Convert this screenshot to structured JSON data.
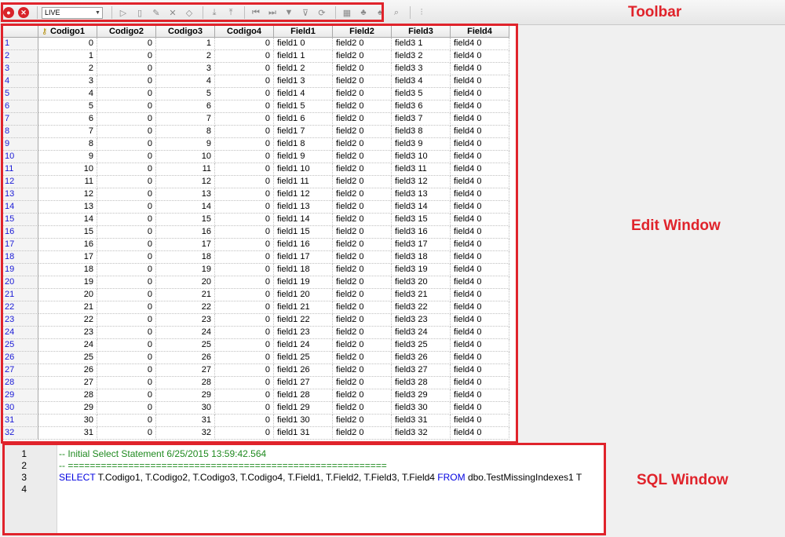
{
  "toolbar": {
    "caption": "Toolbar",
    "connection_value": "LIVE",
    "icons": [
      "stop-icon",
      "cancel-icon",
      "run-icon",
      "new-record-icon",
      "edit-icon",
      "delete-icon",
      "eraser-icon",
      "import-icon",
      "export-icon",
      "first-record-icon",
      "last-record-icon",
      "filter-icon",
      "filter-options-icon",
      "refresh-icon",
      "table-view-icon",
      "group-icon",
      "sort-icon",
      "lookup-icon",
      "split-icon"
    ]
  },
  "edit_window": {
    "caption": "Edit Window",
    "columns": [
      "Codigo1",
      "Codigo2",
      "Codigo3",
      "Codigo4",
      "Field1",
      "Field2",
      "Field3",
      "Field4"
    ],
    "rows": [
      [
        "1",
        "0",
        "0",
        "1",
        "0",
        "field1 0",
        "field2 0",
        "field3 1",
        "field4 0"
      ],
      [
        "2",
        "1",
        "0",
        "2",
        "0",
        "field1 1",
        "field2 0",
        "field3 2",
        "field4 0"
      ],
      [
        "3",
        "2",
        "0",
        "3",
        "0",
        "field1 2",
        "field2 0",
        "field3 3",
        "field4 0"
      ],
      [
        "4",
        "3",
        "0",
        "4",
        "0",
        "field1 3",
        "field2 0",
        "field3 4",
        "field4 0"
      ],
      [
        "5",
        "4",
        "0",
        "5",
        "0",
        "field1 4",
        "field2 0",
        "field3 5",
        "field4 0"
      ],
      [
        "6",
        "5",
        "0",
        "6",
        "0",
        "field1 5",
        "field2 0",
        "field3 6",
        "field4 0"
      ],
      [
        "7",
        "6",
        "0",
        "7",
        "0",
        "field1 6",
        "field2 0",
        "field3 7",
        "field4 0"
      ],
      [
        "8",
        "7",
        "0",
        "8",
        "0",
        "field1 7",
        "field2 0",
        "field3 8",
        "field4 0"
      ],
      [
        "9",
        "8",
        "0",
        "9",
        "0",
        "field1 8",
        "field2 0",
        "field3 9",
        "field4 0"
      ],
      [
        "10",
        "9",
        "0",
        "10",
        "0",
        "field1 9",
        "field2 0",
        "field3 10",
        "field4 0"
      ],
      [
        "11",
        "10",
        "0",
        "11",
        "0",
        "field1 10",
        "field2 0",
        "field3 11",
        "field4 0"
      ],
      [
        "12",
        "11",
        "0",
        "12",
        "0",
        "field1 11",
        "field2 0",
        "field3 12",
        "field4 0"
      ],
      [
        "13",
        "12",
        "0",
        "13",
        "0",
        "field1 12",
        "field2 0",
        "field3 13",
        "field4 0"
      ],
      [
        "14",
        "13",
        "0",
        "14",
        "0",
        "field1 13",
        "field2 0",
        "field3 14",
        "field4 0"
      ],
      [
        "15",
        "14",
        "0",
        "15",
        "0",
        "field1 14",
        "field2 0",
        "field3 15",
        "field4 0"
      ],
      [
        "16",
        "15",
        "0",
        "16",
        "0",
        "field1 15",
        "field2 0",
        "field3 16",
        "field4 0"
      ],
      [
        "17",
        "16",
        "0",
        "17",
        "0",
        "field1 16",
        "field2 0",
        "field3 17",
        "field4 0"
      ],
      [
        "18",
        "17",
        "0",
        "18",
        "0",
        "field1 17",
        "field2 0",
        "field3 18",
        "field4 0"
      ],
      [
        "19",
        "18",
        "0",
        "19",
        "0",
        "field1 18",
        "field2 0",
        "field3 19",
        "field4 0"
      ],
      [
        "20",
        "19",
        "0",
        "20",
        "0",
        "field1 19",
        "field2 0",
        "field3 20",
        "field4 0"
      ],
      [
        "21",
        "20",
        "0",
        "21",
        "0",
        "field1 20",
        "field2 0",
        "field3 21",
        "field4 0"
      ],
      [
        "22",
        "21",
        "0",
        "22",
        "0",
        "field1 21",
        "field2 0",
        "field3 22",
        "field4 0"
      ],
      [
        "23",
        "22",
        "0",
        "23",
        "0",
        "field1 22",
        "field2 0",
        "field3 23",
        "field4 0"
      ],
      [
        "24",
        "23",
        "0",
        "24",
        "0",
        "field1 23",
        "field2 0",
        "field3 24",
        "field4 0"
      ],
      [
        "25",
        "24",
        "0",
        "25",
        "0",
        "field1 24",
        "field2 0",
        "field3 25",
        "field4 0"
      ],
      [
        "26",
        "25",
        "0",
        "26",
        "0",
        "field1 25",
        "field2 0",
        "field3 26",
        "field4 0"
      ],
      [
        "27",
        "26",
        "0",
        "27",
        "0",
        "field1 26",
        "field2 0",
        "field3 27",
        "field4 0"
      ],
      [
        "28",
        "27",
        "0",
        "28",
        "0",
        "field1 27",
        "field2 0",
        "field3 28",
        "field4 0"
      ],
      [
        "29",
        "28",
        "0",
        "29",
        "0",
        "field1 28",
        "field2 0",
        "field3 29",
        "field4 0"
      ],
      [
        "30",
        "29",
        "0",
        "30",
        "0",
        "field1 29",
        "field2 0",
        "field3 30",
        "field4 0"
      ],
      [
        "31",
        "30",
        "0",
        "31",
        "0",
        "field1 30",
        "field2 0",
        "field3 31",
        "field4 0"
      ],
      [
        "32",
        "31",
        "0",
        "32",
        "0",
        "field1 31",
        "field2 0",
        "field3 32",
        "field4 0"
      ]
    ]
  },
  "sql_window": {
    "caption": "SQL Window",
    "line_numbers": [
      "1",
      "2",
      "3",
      "4"
    ],
    "line1": "-- Initial Select Statement 6/25/2015 13:59:42.564",
    "line2": "-- ==========================================================",
    "line3_kw1": "SELECT",
    "line3_mid": " T.Codigo1, T.Codigo2, T.Codigo3, T.Codigo4, T.Field1, T.Field2, T.Field3, T.Field4 ",
    "line3_kw2": "FROM",
    "line3_end": " dbo.TestMissingIndexes1 T"
  },
  "colors": {
    "annotation": "#e0232b",
    "comment": "#1f8a1f",
    "keyword": "#0000e0",
    "row_number": "#1a1ad6"
  }
}
